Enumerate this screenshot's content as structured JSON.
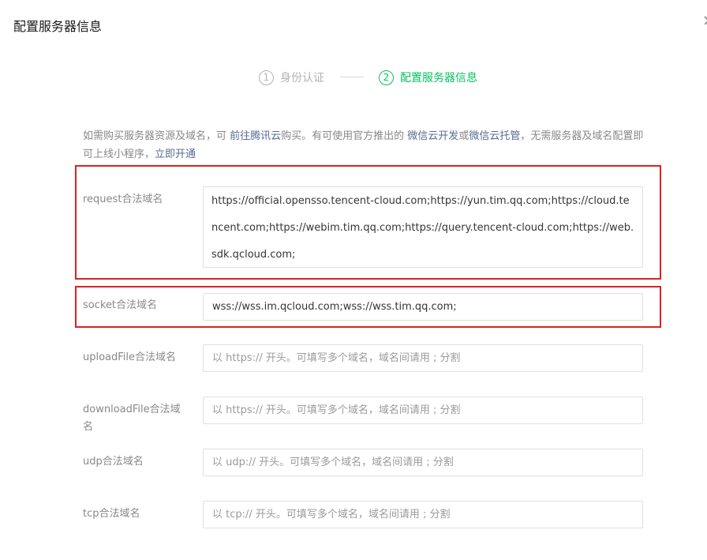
{
  "dialog": {
    "title": "配置服务器信息"
  },
  "steps": [
    {
      "num": "1",
      "label": "身份认证",
      "state": "done"
    },
    {
      "num": "2",
      "label": "配置服务器信息",
      "state": "active"
    }
  ],
  "notice": {
    "part1": "如需购买服务器资源及域名，可 ",
    "link_tencent": "前往腾讯云",
    "part2": "购买。有可使用官方推出的 ",
    "link_cloud_dev": "微信云开发",
    "part3": "或",
    "link_cloud_host": "微信云托管",
    "part4": "，无需服务器及域名配置即可上线小程序，",
    "link_open": "立即开通"
  },
  "fields": [
    {
      "label": "request合法域名",
      "value": "https://official.opensso.tencent-cloud.com;https://yun.tim.qq.com;https://cloud.tencent.com;https://webim.tim.qq.com;https://query.tencent-cloud.com;https://web.sdk.qcloud.com;"
    },
    {
      "label": "socket合法域名",
      "value": "wss://wss.im.qcloud.com;wss://wss.tim.qq.com;"
    },
    {
      "label": "uploadFile合法域名",
      "placeholder": "以 https:// 开头。可填写多个域名，域名间请用 ; 分割"
    },
    {
      "label": "downloadFile合法域名",
      "placeholder": "以 https:// 开头。可填写多个域名，域名间请用 ; 分割"
    },
    {
      "label": "udp合法域名",
      "placeholder": "以 udp:// 开头。可填写多个域名，域名间请用 ; 分割"
    },
    {
      "label": "tcp合法域名",
      "placeholder": "以 tcp:// 开头。可填写多个域名，域名间请用 ; 分割"
    }
  ],
  "colors": {
    "accent": "#07c160",
    "link": "#576b95",
    "highlight": "#e02020"
  }
}
